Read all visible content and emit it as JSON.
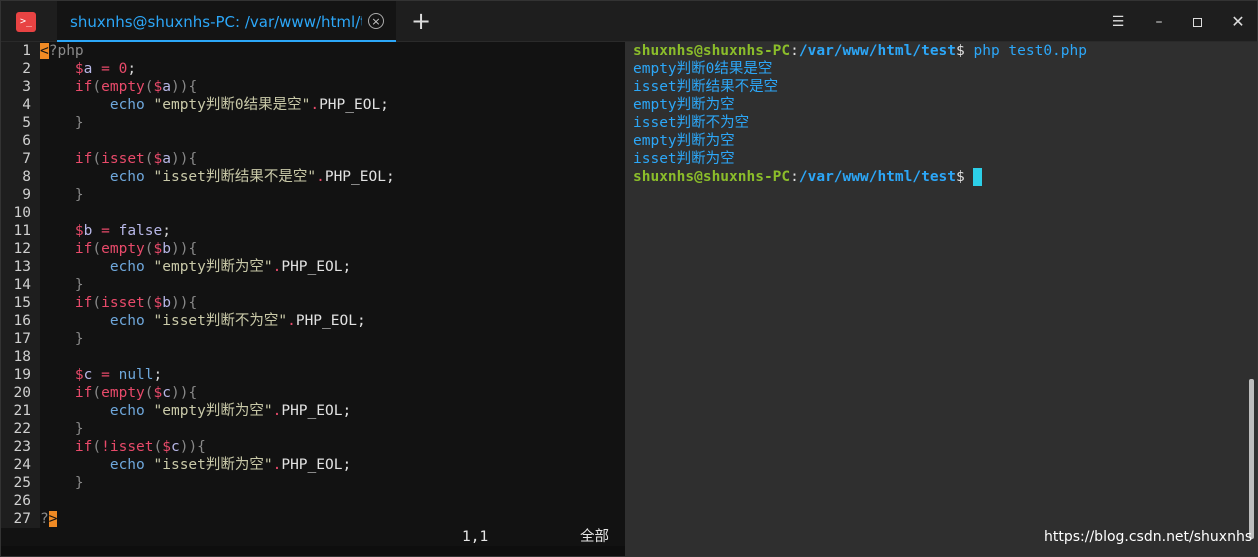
{
  "titlebar": {
    "tab_title": "shuxnhs@shuxnhs-PC: /var/www/html/test",
    "tab_close": "×",
    "add_tab": "+",
    "app_icon": "terminal-icon",
    "menu": "☰",
    "minimize": "–",
    "close": "✕"
  },
  "editor": {
    "cursor_pos": "1,1",
    "scroll_pct": "全部",
    "lines": [
      {
        "n": "1"
      },
      {
        "n": "2"
      },
      {
        "n": "3"
      },
      {
        "n": "4"
      },
      {
        "n": "5"
      },
      {
        "n": "6"
      },
      {
        "n": "7"
      },
      {
        "n": "8"
      },
      {
        "n": "9"
      },
      {
        "n": "10"
      },
      {
        "n": "11"
      },
      {
        "n": "12"
      },
      {
        "n": "13"
      },
      {
        "n": "14"
      },
      {
        "n": "15"
      },
      {
        "n": "16"
      },
      {
        "n": "17"
      },
      {
        "n": "18"
      },
      {
        "n": "19"
      },
      {
        "n": "20"
      },
      {
        "n": "21"
      },
      {
        "n": "22"
      },
      {
        "n": "23"
      },
      {
        "n": "24"
      },
      {
        "n": "25"
      },
      {
        "n": "26"
      },
      {
        "n": "27"
      }
    ],
    "code": {
      "l1a": "<",
      "l1b": "?php",
      "l2": "    $a = 0;",
      "l3": "    if(empty($a)){",
      "l4a": "        echo ",
      "l4b": "\"empty判断0结果是空\"",
      "l4c": ".",
      "l4d": "PHP_EOL;",
      "l5": "    }",
      "l7": "    if(isset($a)){",
      "l8a": "        echo ",
      "l8b": "\"isset判断结果不是空\"",
      "l8c": ".",
      "l8d": "PHP_EOL;",
      "l9": "    }",
      "l11": "    $b = false;",
      "l12": "    if(empty($b)){",
      "l13a": "        echo ",
      "l13b": "\"empty判断为空\"",
      "l13c": ".",
      "l13d": "PHP_EOL;",
      "l14": "    }",
      "l15": "    if(isset($b)){",
      "l16a": "        echo ",
      "l16b": "\"isset判断不为空\"",
      "l16c": ".",
      "l16d": "PHP_EOL;",
      "l17": "    }",
      "l19": "    $c = null;",
      "l20": "    if(empty($c)){",
      "l21a": "        echo ",
      "l21b": "\"empty判断为空\"",
      "l21c": ".",
      "l21d": "PHP_EOL;",
      "l22": "    }",
      "l23": "    if(!isset($c)){",
      "l24a": "        echo ",
      "l24b": "\"isset判断为空\"",
      "l24c": ".",
      "l24d": "PHP_EOL;",
      "l25": "    }",
      "l27a": "?",
      "l27b": ">"
    }
  },
  "terminal": {
    "user": "shuxnhs@shuxnhs-PC",
    "colon": ":",
    "path": "/var/www/html/test",
    "dollar": "$",
    "command": " php test0.php",
    "output": [
      "empty判断0结果是空",
      "isset判断结果不是空",
      "empty判断为空",
      "isset判断不为空",
      "empty判断为空",
      "isset判断为空"
    ]
  },
  "watermark": "https://blog.csdn.net/shuxnhs"
}
